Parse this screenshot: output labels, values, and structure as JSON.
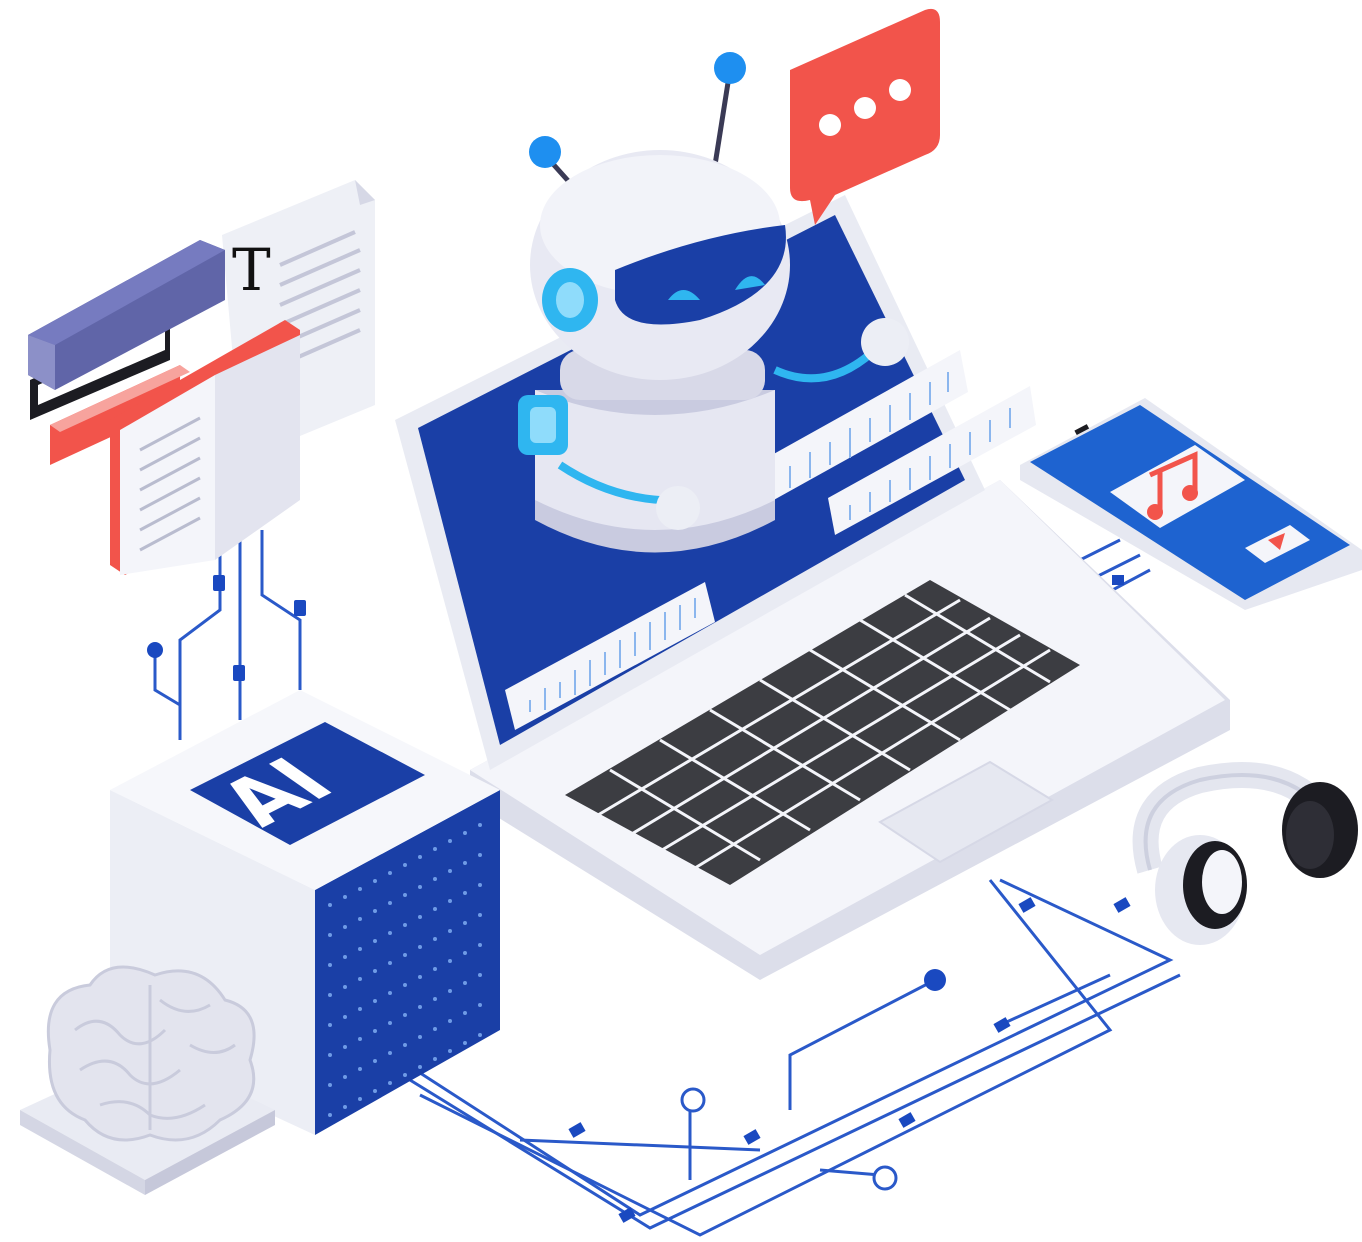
{
  "illustration": {
    "page_glyph": "T",
    "cube_label": "AI"
  },
  "colors": {
    "brand_blue": "#1a3fa6",
    "bright_blue": "#1e6fd9",
    "cyan": "#2fb6f0",
    "alert_red": "#f2544b",
    "key_gray": "#3c3d42",
    "body_white": "#eef0f6",
    "shadow_lavender": "#c9cbe0"
  },
  "icons": [
    "robot-icon",
    "chat-bubble-icon",
    "laptop-icon",
    "books-icon",
    "document-icon",
    "ai-cube-icon",
    "brain-icon",
    "phone-icon",
    "music-note-icon",
    "play-icon",
    "headphones-icon",
    "circuit-lines-icon",
    "soundwave-icon"
  ]
}
